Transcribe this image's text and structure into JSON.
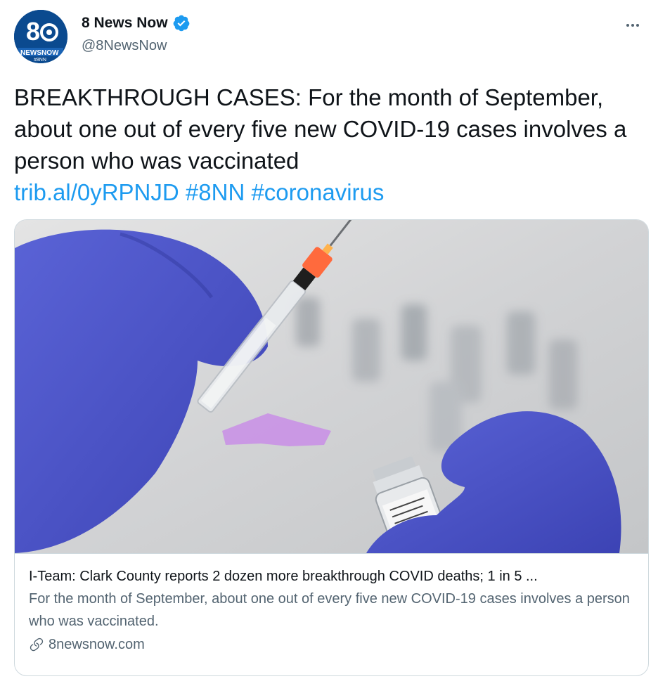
{
  "author": {
    "display_name": "8 News Now",
    "handle": "@8NewsNow",
    "verified": true,
    "avatar": {
      "icon": "8newsnow-logo",
      "logo_text": [
        "8",
        "NEWSNOW",
        "#8NN"
      ]
    }
  },
  "menu": {
    "icon": "more-horizontal-icon"
  },
  "tweet": {
    "text": "BREAKTHROUGH CASES: For the month of September, about one out of every five new COVID-19 cases involves a person who was vaccinated",
    "link": "trib.al/0yRPNJD",
    "hashtags": [
      "#8NN",
      "#coronavirus"
    ]
  },
  "card": {
    "image_alt": "",
    "title": "I-Team: Clark County reports 2 dozen more breakthrough COVID deaths; 1 in 5 ...",
    "description": "For the month of September, about one out of every five new COVID-19 cases involves a person who was vaccinated.",
    "domain": "8newsnow.com",
    "domain_icon": "link-icon"
  },
  "colors": {
    "link": "#1d9bf0",
    "text": "#0f1419",
    "secondary": "#536471",
    "border": "#cfd9de",
    "verified": "#1d9bf0"
  }
}
